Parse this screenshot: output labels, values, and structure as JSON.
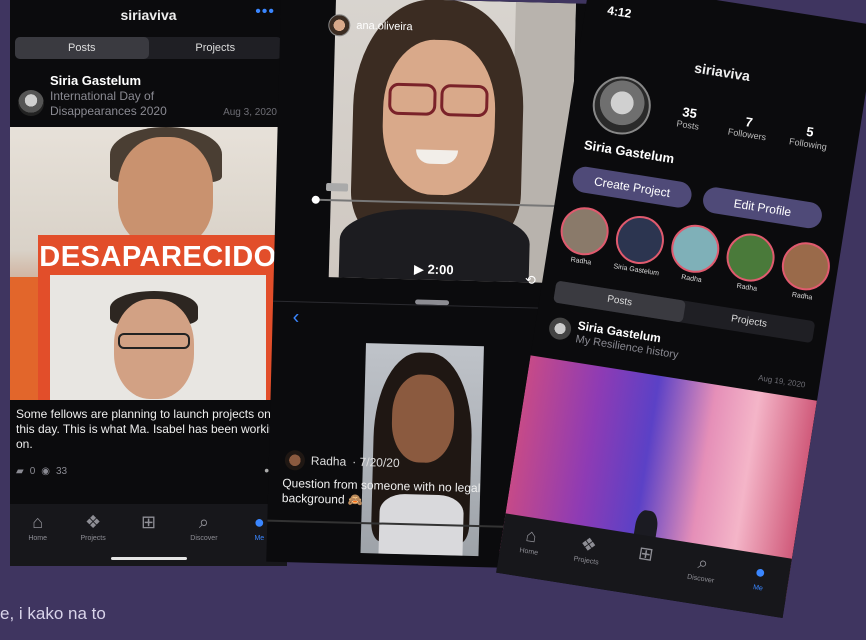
{
  "phone1": {
    "title": "siriaviva",
    "more_icon": "ellipsis-icon",
    "tabs": [
      "Posts",
      "Projects"
    ],
    "post": {
      "author": "Siria Gastelum",
      "subtitle": "International Day of Disappearances 2020",
      "date": "Aug 3, 2020",
      "sign_text": "DESAPARECIDO",
      "body": "Some fellows are planning to launch projects on this day. This is what Ma. Isabel has been working on.",
      "comments": "0",
      "views": "33"
    },
    "tabbar": [
      {
        "label": "Home",
        "icon": "home-icon",
        "glyph": "⌂"
      },
      {
        "label": "Projects",
        "icon": "projects-icon",
        "glyph": "❖"
      },
      {
        "label": "",
        "icon": "add-icon",
        "glyph": "⊞"
      },
      {
        "label": "Discover",
        "icon": "search-icon",
        "glyph": "⌕"
      },
      {
        "label": "Me",
        "icon": "person-icon",
        "glyph": "●"
      }
    ]
  },
  "phone2": {
    "username": "ana.oliveira",
    "close_glyph": "×",
    "duration": "▶ 2:00",
    "back_glyph": "‹",
    "reply": {
      "author": "Radha",
      "date": "· 7/20/20",
      "question": "Question from someone with no legal background 🙈"
    }
  },
  "phone3": {
    "clock": "4:12",
    "title": "siriaviva",
    "name": "Siria Gastelum",
    "stats": [
      {
        "value": "35",
        "label": "Posts"
      },
      {
        "value": "7",
        "label": "Followers"
      },
      {
        "value": "5",
        "label": "Following"
      }
    ],
    "buttons": {
      "create": "Create Project",
      "edit": "Edit Profile"
    },
    "circles": [
      "Radha",
      "Siria Gastelum",
      "Radha",
      "Radha",
      "Radha"
    ],
    "tabs": [
      "Posts",
      "Projects"
    ],
    "post": {
      "author": "Siria Gastelum",
      "subtitle": "My Resilience history",
      "date": "Aug 19, 2020"
    },
    "tabbar": [
      {
        "label": "Home",
        "icon": "home-icon",
        "glyph": "⌂"
      },
      {
        "label": "Projects",
        "icon": "projects-icon",
        "glyph": "❖"
      },
      {
        "label": "",
        "icon": "add-icon",
        "glyph": "⊞"
      },
      {
        "label": "Discover",
        "icon": "search-icon",
        "glyph": "⌕"
      },
      {
        "label": "Me",
        "icon": "person-icon",
        "glyph": "●"
      }
    ]
  },
  "caption": "e, i kako na to",
  "colors": {
    "background": "#3f3560",
    "accent": "#3a86ff",
    "button": "#4f4a78",
    "story_ring": "#e05a6e"
  }
}
